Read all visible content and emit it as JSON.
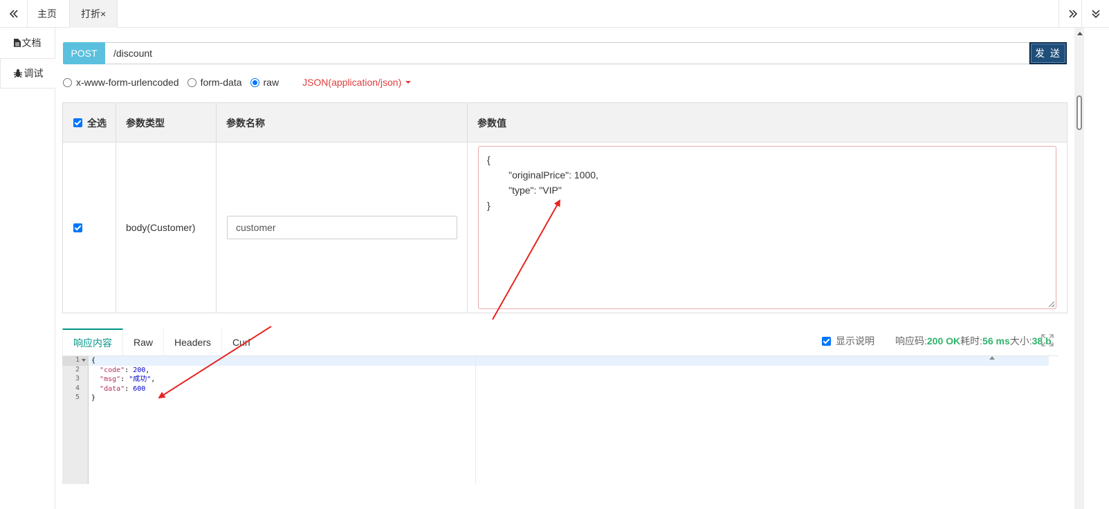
{
  "topbar": {
    "home_tab": "主页",
    "active_tab": "打折",
    "active_tab_close": "×",
    "nav_left_icon": "double-chevron-left-icon",
    "nav_right_icon": "double-chevron-right-icon",
    "nav_down_icon": "double-chevron-down-icon"
  },
  "sidebar": {
    "items": [
      {
        "label": "文档",
        "icon": "document-icon"
      },
      {
        "label": "调试",
        "icon": "bug-icon"
      }
    ]
  },
  "request": {
    "method": "POST",
    "url": "/discount",
    "send_label": "发 送"
  },
  "content_types": {
    "options": [
      {
        "label": "x-www-form-urlencoded",
        "checked": false
      },
      {
        "label": "form-data",
        "checked": false
      },
      {
        "label": "raw",
        "checked": true
      }
    ],
    "raw_type": "JSON(application/json)"
  },
  "params_table": {
    "headers": {
      "select_all": "全选",
      "type": "参数类型",
      "name": "参数名称",
      "value": "参数值"
    },
    "row": {
      "checked": true,
      "type": "body(Customer)",
      "name_placeholder": "customer",
      "value_lines": [
        "{",
        "        \"originalPrice\": 1000,",
        "        \"type\": \"VIP\"",
        "}"
      ]
    }
  },
  "response": {
    "tabs": [
      "响应内容",
      "Raw",
      "Headers",
      "Curl"
    ],
    "show_desc_label": "显示说明",
    "status_label": "响应码:",
    "status_value": "200 OK",
    "time_label": "耗时:",
    "time_value": "56 ms",
    "size_label": "大小:",
    "size_value": "38 b",
    "line_numbers": [
      "1",
      "2",
      "3",
      "4",
      "5"
    ],
    "body": {
      "code": 200,
      "msg": "成功",
      "data": 600
    }
  },
  "colors": {
    "accent": "#009688",
    "method_bg": "#5bc0de",
    "send_bg": "#1f4e79",
    "json_type": "#e03c3c",
    "status_green": "#2fb36b",
    "annotation_arrow": "#e8231f"
  }
}
